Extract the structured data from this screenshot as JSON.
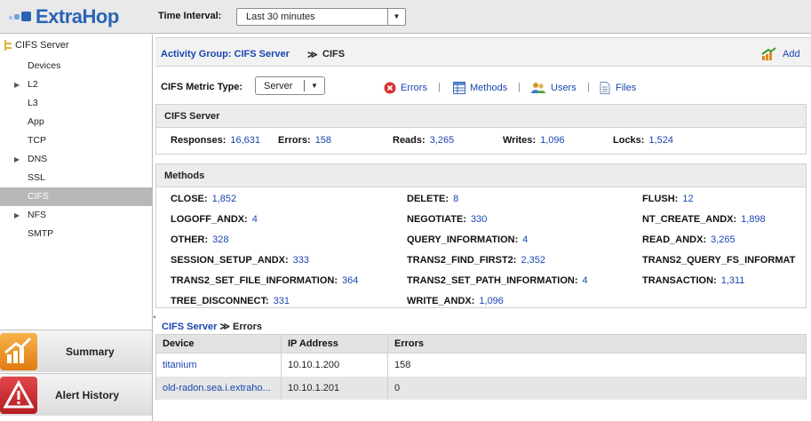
{
  "app": {
    "logo_text": "ExtraHop"
  },
  "toolbar": {
    "time_interval_label": "Time Interval:",
    "time_interval_value": "Last 30 minutes"
  },
  "sidebar": {
    "group_title": "CIFS Server",
    "items": [
      {
        "label": "Devices",
        "expandable": false,
        "selected": false
      },
      {
        "label": "L2",
        "expandable": true,
        "selected": false
      },
      {
        "label": "L3",
        "expandable": false,
        "selected": false
      },
      {
        "label": "App",
        "expandable": false,
        "selected": false
      },
      {
        "label": "TCP",
        "expandable": false,
        "selected": false
      },
      {
        "label": "DNS",
        "expandable": true,
        "selected": false
      },
      {
        "label": "SSL",
        "expandable": false,
        "selected": false
      },
      {
        "label": "CIFS",
        "expandable": false,
        "selected": true
      },
      {
        "label": "NFS",
        "expandable": true,
        "selected": false
      },
      {
        "label": "SMTP",
        "expandable": false,
        "selected": false
      }
    ],
    "bottom": [
      {
        "label": "Summary",
        "icon": "summary-chart-icon"
      },
      {
        "label": "Alert History",
        "icon": "alert-icon"
      }
    ]
  },
  "breadcrumb": {
    "group_link": "Activity Group: CIFS Server",
    "separator": "≫",
    "current": "CIFS",
    "add_label": "Add"
  },
  "metric_type": {
    "label": "CIFS Metric Type:",
    "value": "Server",
    "tools": [
      {
        "label": "Errors",
        "icon": "error-icon"
      },
      {
        "label": "Methods",
        "icon": "methods-icon"
      },
      {
        "label": "Users",
        "icon": "users-icon"
      },
      {
        "label": "Files",
        "icon": "files-icon"
      }
    ]
  },
  "summary_panel": {
    "title": "CIFS Server",
    "stats": [
      {
        "key": "Responses:",
        "value": "16,631"
      },
      {
        "key": "Errors:",
        "value": "158"
      },
      {
        "key": "Reads:",
        "value": "3,265"
      },
      {
        "key": "Writes:",
        "value": "1,096"
      },
      {
        "key": "Locks:",
        "value": "1,524"
      }
    ]
  },
  "methods_panel": {
    "title": "Methods",
    "rows": [
      [
        {
          "key": "CLOSE:",
          "value": "1,852"
        },
        {
          "key": "DELETE:",
          "value": "8"
        },
        {
          "key": "FLUSH:",
          "value": "12"
        }
      ],
      [
        {
          "key": "LOGOFF_ANDX:",
          "value": "4"
        },
        {
          "key": "NEGOTIATE:",
          "value": "330"
        },
        {
          "key": "NT_CREATE_ANDX:",
          "value": "1,898"
        }
      ],
      [
        {
          "key": "OTHER:",
          "value": "328"
        },
        {
          "key": "QUERY_INFORMATION:",
          "value": "4"
        },
        {
          "key": "READ_ANDX:",
          "value": "3,265"
        }
      ],
      [
        {
          "key": "SESSION_SETUP_ANDX:",
          "value": "333"
        },
        {
          "key": "TRANS2_FIND_FIRST2:",
          "value": "2,352"
        },
        {
          "key": "TRANS2_QUERY_FS_INFORMAT",
          "value": ""
        }
      ],
      [
        {
          "key": "TRANS2_SET_FILE_INFORMATION:",
          "value": "364"
        },
        {
          "key": "TRANS2_SET_PATH_INFORMATION:",
          "value": "4"
        },
        {
          "key": "TRANSACTION:",
          "value": "1,311"
        }
      ],
      [
        {
          "key": "TREE_DISCONNECT:",
          "value": "331"
        },
        {
          "key": "WRITE_ANDX:",
          "value": "1,096"
        }
      ]
    ]
  },
  "errors_table": {
    "title_link": "CIFS Server",
    "title_sep": "≫",
    "title_rest": "Errors",
    "columns": [
      "Device",
      "IP Address",
      "Errors"
    ],
    "rows": [
      {
        "device": "titanium",
        "ip": "10.10.1.200",
        "errors": "158"
      },
      {
        "device": "old-radon.sea.i.extraho...",
        "ip": "10.10.1.201",
        "errors": "0"
      }
    ]
  },
  "colors": {
    "link": "#1a46b0",
    "logo": "#2a63b5",
    "selected_row": "#b8b8b8"
  }
}
